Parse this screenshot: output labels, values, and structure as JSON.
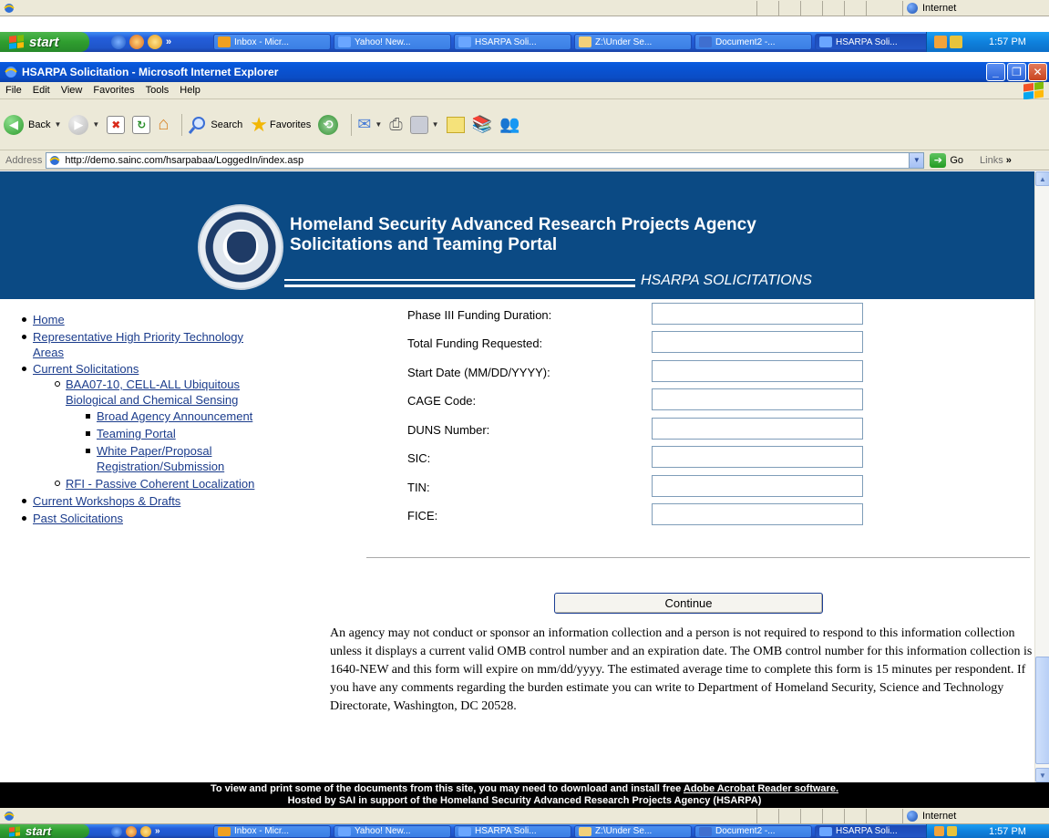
{
  "top_status": {
    "zone": "Internet"
  },
  "taskbar": {
    "start_label": "start",
    "tasks": [
      "Inbox - Micr...",
      "Yahoo! New...",
      "HSARPA Soli...",
      "Z:\\Under Se...",
      "Document2 -...",
      "HSARPA Soli..."
    ],
    "clock": "1:57 PM",
    "chevron": "»"
  },
  "window": {
    "title": "HSARPA Solicitation - Microsoft Internet Explorer",
    "menu": [
      "File",
      "Edit",
      "View",
      "Favorites",
      "Tools",
      "Help"
    ]
  },
  "toolbar": {
    "back_label": "Back",
    "search_label": "Search",
    "favorites_label": "Favorites"
  },
  "address": {
    "label": "Address",
    "url": "http://demo.sainc.com/hsarpabaa/LoggedIn/index.asp",
    "go_label": "Go",
    "links_label": "Links"
  },
  "banner": {
    "title_line1": "Homeland Security Advanced Research Projects Agency",
    "title_line2": "Solicitations and Teaming Portal",
    "tag": "HSARPA SOLICITATIONS"
  },
  "nav": {
    "home": "Home",
    "tech_line1": "Representative High Priority Technology",
    "tech_line2": "Areas",
    "current": "Current Solicitations",
    "baa_line1": "BAA07-10, CELL-ALL Ubiquitous",
    "baa_line2": "Biological and Chemical Sensing",
    "broad": "Broad Agency Announcement",
    "teaming": "Teaming Portal",
    "white_line1": "White Paper/Proposal",
    "white_line2": "Registration/Submission",
    "rfi": "RFI - Passive Coherent Localization",
    "workshops": "Current Workshops & Drafts",
    "past": "Past Solicitations"
  },
  "form": {
    "fields": [
      {
        "label": "Phase III Funding Duration:",
        "value": ""
      },
      {
        "label": "Total Funding Requested:",
        "value": ""
      },
      {
        "label": "Start Date (MM/DD/YYYY):",
        "value": ""
      },
      {
        "label": "CAGE Code:",
        "value": ""
      },
      {
        "label": "DUNS Number:",
        "value": ""
      },
      {
        "label": "SIC:",
        "value": ""
      },
      {
        "label": "TIN:",
        "value": ""
      },
      {
        "label": "FICE:",
        "value": ""
      }
    ],
    "continue_label": "Continue",
    "omb_notice": "An agency may not conduct or sponsor an information collection and a person is not required to respond to this information collection unless it displays a current valid OMB control number and an expiration date. The OMB control number for this information collection is 1640-NEW and this form will expire on mm/dd/yyyy. The estimated average time to complete this form is 15 minutes per respondent. If you have any comments regarding the burden estimate you can write to Department of Homeland Security, Science and Technology Directorate, Washington, DC 20528."
  },
  "footer": {
    "line1_prefix": "To view and print some of the documents from this site, you may need to download and install free ",
    "line1_link": "Adobe Acrobat Reader software.",
    "line2": "Hosted by SAI in support of the Homeland Security Advanced Research Projects Agency (HSARPA)"
  },
  "bottom_status": {
    "zone": "Internet"
  }
}
